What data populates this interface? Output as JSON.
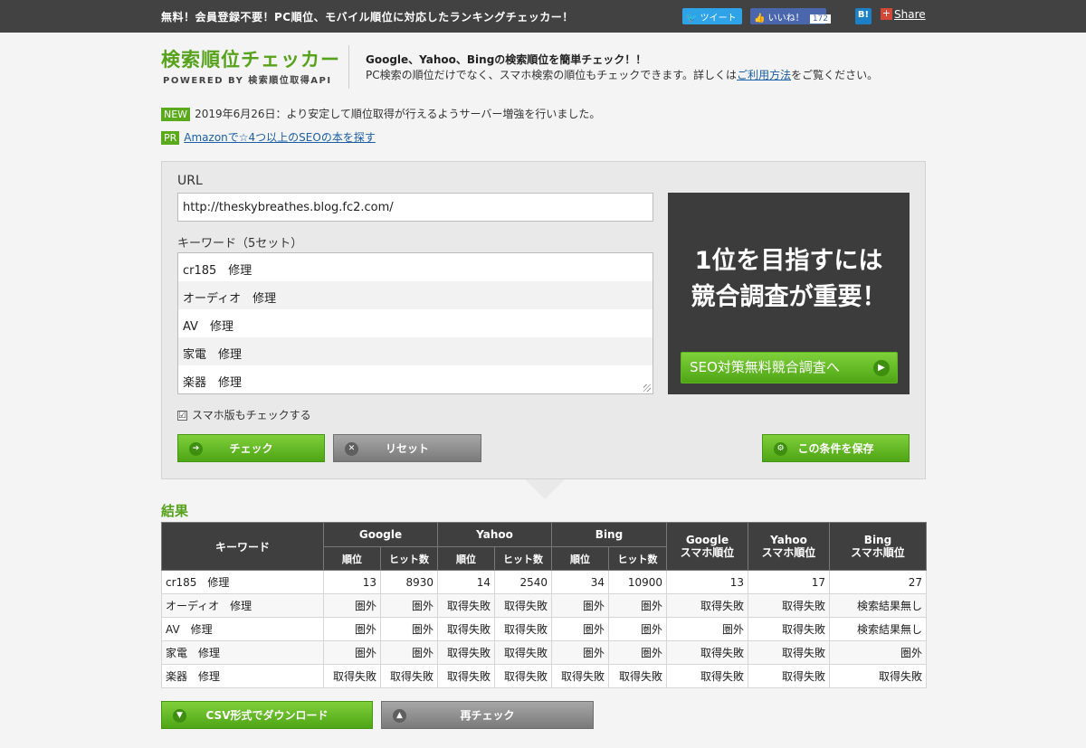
{
  "topbar": {
    "tagline": "無料！会員登録不要！PC順位、モバイル順位に対応したランキングチェッカー！",
    "tweet_label": "ツイート",
    "like_label": "いいね！",
    "like_count": "172",
    "hatena_label": "B!",
    "share_label": "Share"
  },
  "header": {
    "logo_title": "検索順位チェッカー",
    "logo_sub": "POWERED BY 検索順位取得API",
    "lead": "Google、Yahoo、Bingの検索順位を簡単チェック！！",
    "desc_before": "PC検索の順位だけでなく、スマホ検索の順位もチェックできます。詳しくは",
    "desc_link": "ご利用方法",
    "desc_after": "をご覧ください。"
  },
  "news": [
    {
      "tag": "NEW",
      "text": "2019年6月26日：より安定して順位取得が行えるようサーバー増強を行いました。"
    },
    {
      "tag": "PR",
      "link": "Amazonで☆4つ以上のSEOの本を探す"
    }
  ],
  "form": {
    "url_label": "URL",
    "url_value": "http://theskybreathes.blog.fc2.com/",
    "keywords_label": "キーワード（5セット）",
    "keywords": [
      "cr185　修理",
      "オーディオ　修理",
      "AV　修理",
      "家電　修理",
      "楽器　修理"
    ],
    "sp_check_label": "スマホ版もチェックする",
    "sp_checked": "☑",
    "check_button": "チェック",
    "reset_button": "リセット",
    "save_button": "この条件を保存"
  },
  "ad": {
    "line1": "1位を目指すには",
    "line2": "競合調査が重要！",
    "button": "SEO対策無料競合調査へ"
  },
  "results": {
    "title": "結果",
    "headers": {
      "keyword": "キーワード",
      "google": "Google",
      "yahoo": "Yahoo",
      "bing": "Bing",
      "google_sp_1": "Google",
      "google_sp_2": "スマホ順位",
      "yahoo_sp_1": "Yahoo",
      "yahoo_sp_2": "スマホ順位",
      "bing_sp_1": "Bing",
      "bing_sp_2": "スマホ順位",
      "rank": "順位",
      "hits": "ヒット数"
    },
    "rows": [
      [
        "cr185　修理",
        "13",
        "8930",
        "14",
        "2540",
        "34",
        "10900",
        "13",
        "17",
        "27"
      ],
      [
        "オーディオ　修理",
        "圏外",
        "圏外",
        "取得失敗",
        "取得失敗",
        "圏外",
        "圏外",
        "取得失敗",
        "取得失敗",
        "検索結果無し"
      ],
      [
        "AV　修理",
        "圏外",
        "圏外",
        "取得失敗",
        "取得失敗",
        "圏外",
        "圏外",
        "圏外",
        "取得失敗",
        "検索結果無し"
      ],
      [
        "家電　修理",
        "圏外",
        "圏外",
        "取得失敗",
        "取得失敗",
        "圏外",
        "圏外",
        "取得失敗",
        "取得失敗",
        "圏外"
      ],
      [
        "楽器　修理",
        "取得失敗",
        "取得失敗",
        "取得失敗",
        "取得失敗",
        "取得失敗",
        "取得失敗",
        "取得失敗",
        "取得失敗",
        "取得失敗"
      ]
    ],
    "csv_button": "CSV形式でダウンロード",
    "recheck_button": "再チェック"
  }
}
